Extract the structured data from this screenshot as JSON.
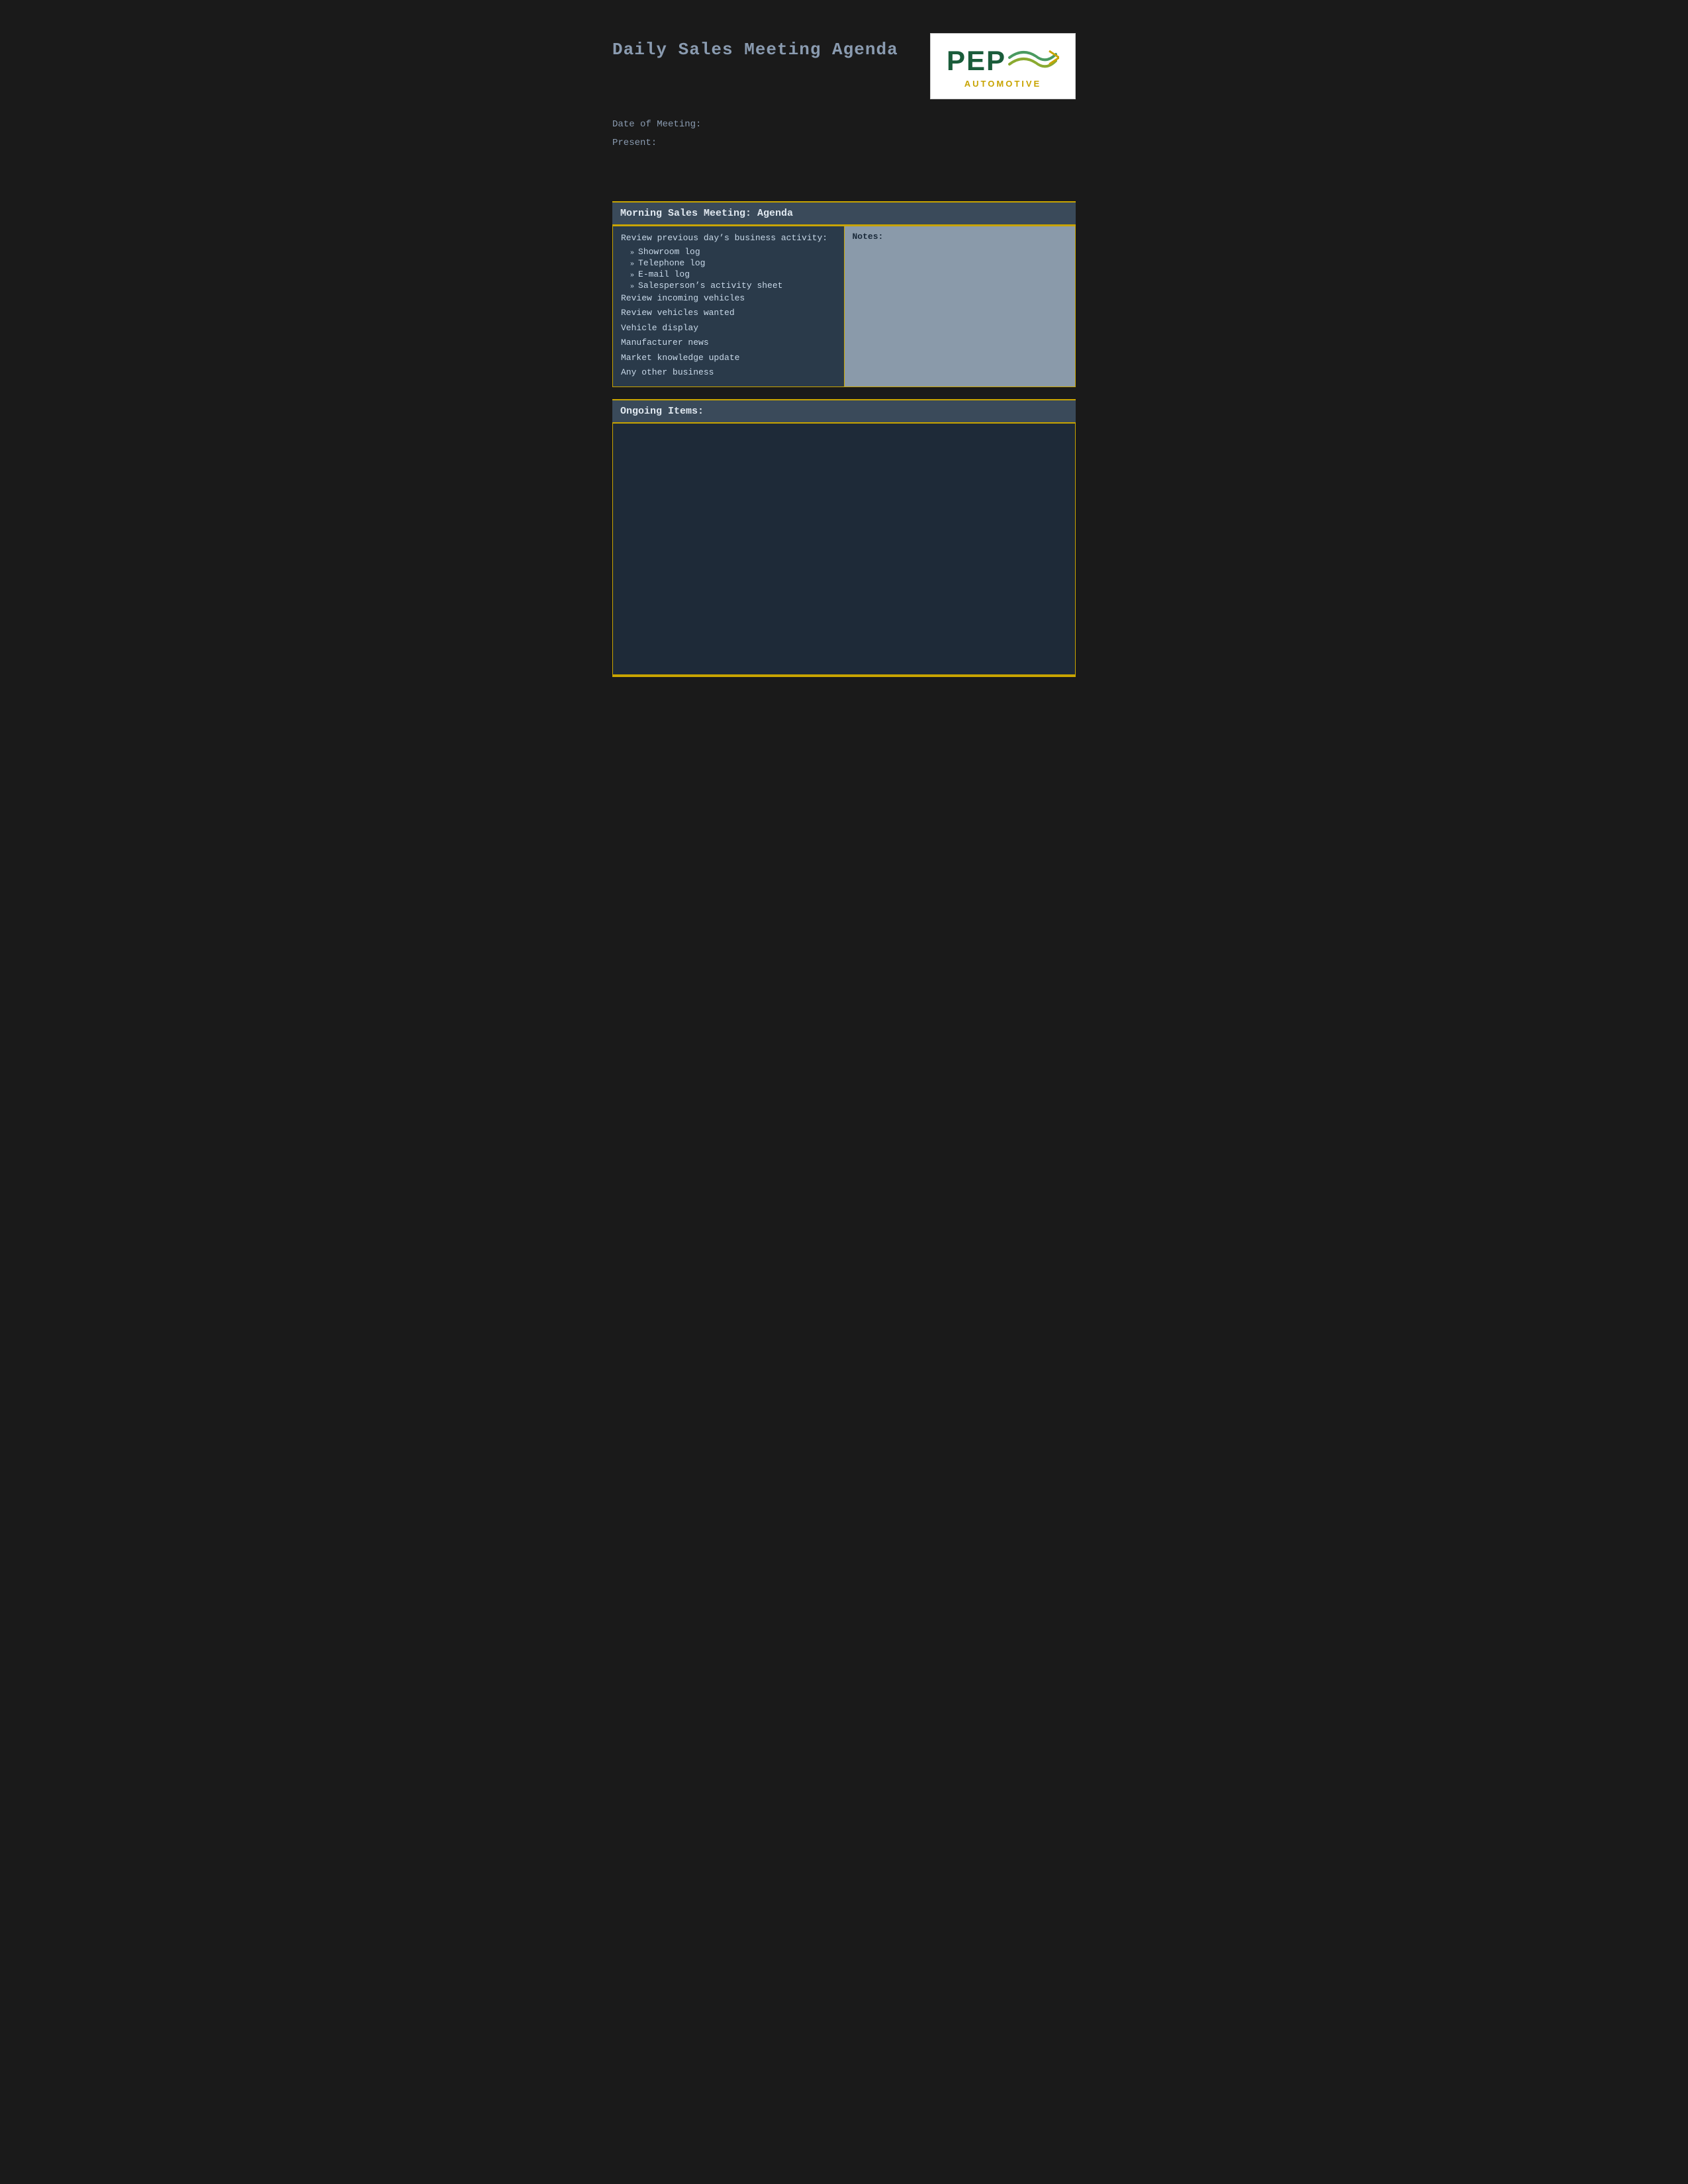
{
  "page": {
    "title": "Daily Sales Meeting Agenda",
    "background": "#1a1a1a"
  },
  "logo": {
    "pep_text": "PEP",
    "automotive_text": "AUTOMOTIVE",
    "arrow_color": "#c8a400",
    "wave_color_green": "#4a9a60",
    "wave_color_olive": "#8aaa30"
  },
  "meta": {
    "date_label": "Date of Meeting:",
    "present_label": "Present:"
  },
  "morning_section": {
    "header": "Morning Sales Meeting: Agenda",
    "left_col": {
      "intro": "Review previous day’s business activity:",
      "bullets": [
        "Showroom log",
        "Telephone log",
        "E-mail log",
        "Salesperson’s activity sheet"
      ],
      "items": [
        "Review incoming vehicles",
        "Review vehicles wanted",
        "Vehicle display",
        "Manufacturer news",
        "Market knowledge update",
        "Any other business"
      ]
    },
    "right_col": {
      "label": "Notes:"
    }
  },
  "ongoing_section": {
    "header": "Ongoing Items:"
  },
  "colors": {
    "gold": "#c8a400",
    "dark_header_bg": "#3a4a5a",
    "content_bg": "#2a3a4a",
    "notes_bg": "#8a9aaa",
    "ongoing_bg": "#1e2a38",
    "text_light": "#c8d8e8",
    "header_text": "#e0e8f0",
    "meta_text": "#8a9bb0"
  }
}
